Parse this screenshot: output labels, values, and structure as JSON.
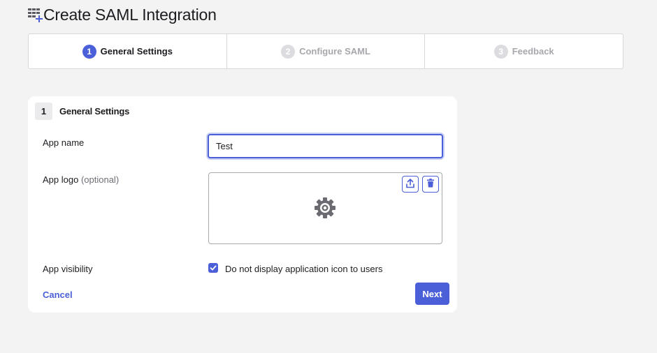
{
  "page": {
    "title": "Create SAML Integration",
    "title_icon": "app-grid-plus-icon"
  },
  "stepper": {
    "steps": [
      {
        "number": "1",
        "label": "General Settings",
        "state": "active"
      },
      {
        "number": "2",
        "label": "Configure SAML",
        "state": "inactive"
      },
      {
        "number": "3",
        "label": "Feedback",
        "state": "inactive"
      }
    ]
  },
  "form": {
    "section_number": "1",
    "section_title": "General Settings",
    "app_name_label": "App name",
    "app_name_value": "Test",
    "app_logo_label": "App logo",
    "app_logo_optional": "(optional)",
    "logo_placeholder_icon": "gear-icon",
    "upload_icon": "upload-icon",
    "delete_icon": "trash-icon",
    "visibility_label": "App visibility",
    "visibility_checkbox_checked": true,
    "visibility_checkbox_label": "Do not display application icon to users",
    "cancel_label": "Cancel",
    "next_label": "Next"
  },
  "colors": {
    "accent": "#4a5fd8",
    "background": "#f3f3f4",
    "card": "#ffffff",
    "inactive_step": "#a7a7ad"
  }
}
